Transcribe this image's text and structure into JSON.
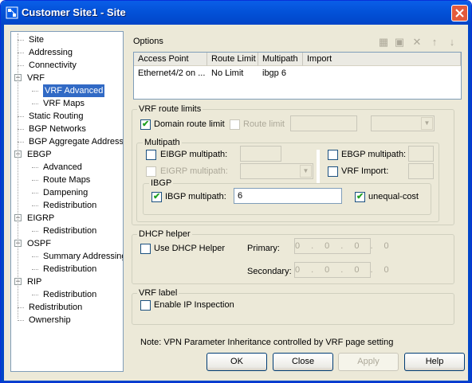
{
  "window": {
    "title": "Customer Site1 - Site"
  },
  "tree": [
    {
      "label": "Site",
      "level": 1
    },
    {
      "label": "Addressing",
      "level": 1
    },
    {
      "label": "Connectivity",
      "level": 1
    },
    {
      "label": "VRF",
      "level": 0,
      "expander": "−"
    },
    {
      "label": "VRF Advanced",
      "level": 2,
      "selected": true
    },
    {
      "label": "VRF Maps",
      "level": 2
    },
    {
      "label": "Static Routing",
      "level": 1
    },
    {
      "label": "BGP Networks",
      "level": 1
    },
    {
      "label": "BGP Aggregate Address",
      "level": 1
    },
    {
      "label": "EBGP",
      "level": 0,
      "expander": "−"
    },
    {
      "label": "Advanced",
      "level": 2
    },
    {
      "label": "Route Maps",
      "level": 2
    },
    {
      "label": "Dampening",
      "level": 2
    },
    {
      "label": "Redistribution",
      "level": 2
    },
    {
      "label": "EIGRP",
      "level": 0,
      "expander": "−"
    },
    {
      "label": "Redistribution",
      "level": 2
    },
    {
      "label": "OSPF",
      "level": 0,
      "expander": "−"
    },
    {
      "label": "Summary Addressing",
      "level": 2
    },
    {
      "label": "Redistribution",
      "level": 2
    },
    {
      "label": "RIP",
      "level": 0,
      "expander": "−"
    },
    {
      "label": "Redistribution",
      "level": 2
    },
    {
      "label": "Redistribution",
      "level": 1
    },
    {
      "label": "Ownership",
      "level": 1
    }
  ],
  "options": {
    "title": "Options",
    "columns": [
      "Access Point",
      "Route Limit",
      "Multipath",
      "Import"
    ],
    "rows": [
      [
        "Ethernet4/2 on ...",
        "No Limit",
        "ibgp 6",
        ""
      ]
    ]
  },
  "vrf_route_limits": {
    "title": "VRF route limits",
    "domain_route_limit": "Domain route limit",
    "route_limit": "Route limit"
  },
  "multipath": {
    "title": "Multipath",
    "eibgp": "EIBGP multipath:",
    "ebgp": "EBGP multipath:",
    "eigrp": "EIGRP multipath:",
    "vrf_import": "VRF Import:"
  },
  "ibgp": {
    "title": "IBGP",
    "label": "IBGP multipath:",
    "value": "6",
    "unequal": "unequal-cost"
  },
  "dhcp": {
    "title": "DHCP helper",
    "use": "Use DHCP Helper",
    "primary": "Primary:",
    "secondary": "Secondary:",
    "primary_ip": "0.0.0.0",
    "secondary_ip": "0.0.0.0"
  },
  "vrf_label": {
    "title": "VRF label",
    "inspection": "Enable IP Inspection"
  },
  "note": "Note: VPN Parameter Inheritance controlled by VRF page setting",
  "buttons": {
    "ok": "OK",
    "close": "Close",
    "apply": "Apply",
    "help": "Help"
  },
  "colors": {
    "titlebar": "#0352D8",
    "selection": "#316AC5",
    "dialog": "#ECE9D8"
  }
}
